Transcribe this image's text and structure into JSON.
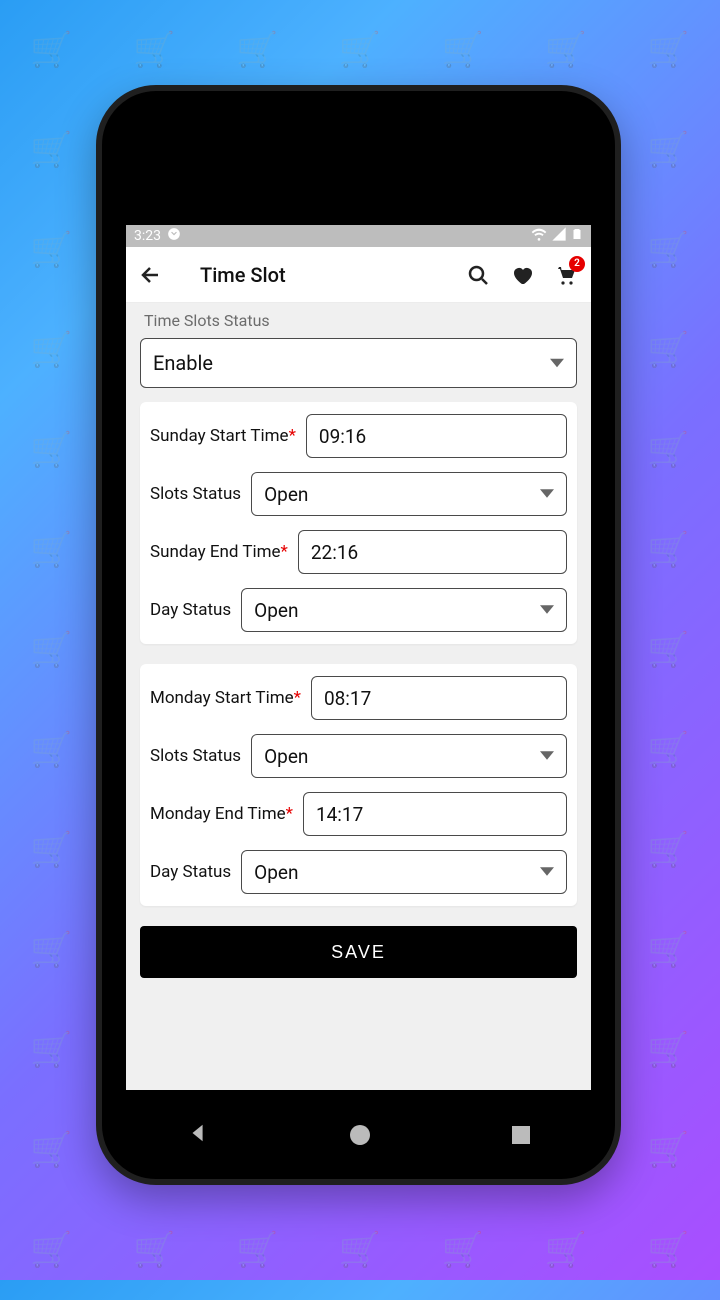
{
  "statusbar": {
    "time": "3:23"
  },
  "appbar": {
    "title": "Time Slot",
    "cart_badge": "2"
  },
  "subtitle": "Time Slots Status",
  "enable_select": "Enable",
  "days": [
    {
      "start_label": "Sunday Start Time",
      "start_value": "09:16",
      "slot_label": "Slots Status",
      "slot_value": "Open",
      "end_label": "Sunday End Time",
      "end_value": "22:16",
      "day_label": "Day Status",
      "day_value": "Open"
    },
    {
      "start_label": "Monday Start Time",
      "start_value": "08:17",
      "slot_label": "Slots Status",
      "slot_value": "Open",
      "end_label": "Monday End Time",
      "end_value": "14:17",
      "day_label": "Day Status",
      "day_value": "Open"
    }
  ],
  "save_label": "SAVE"
}
